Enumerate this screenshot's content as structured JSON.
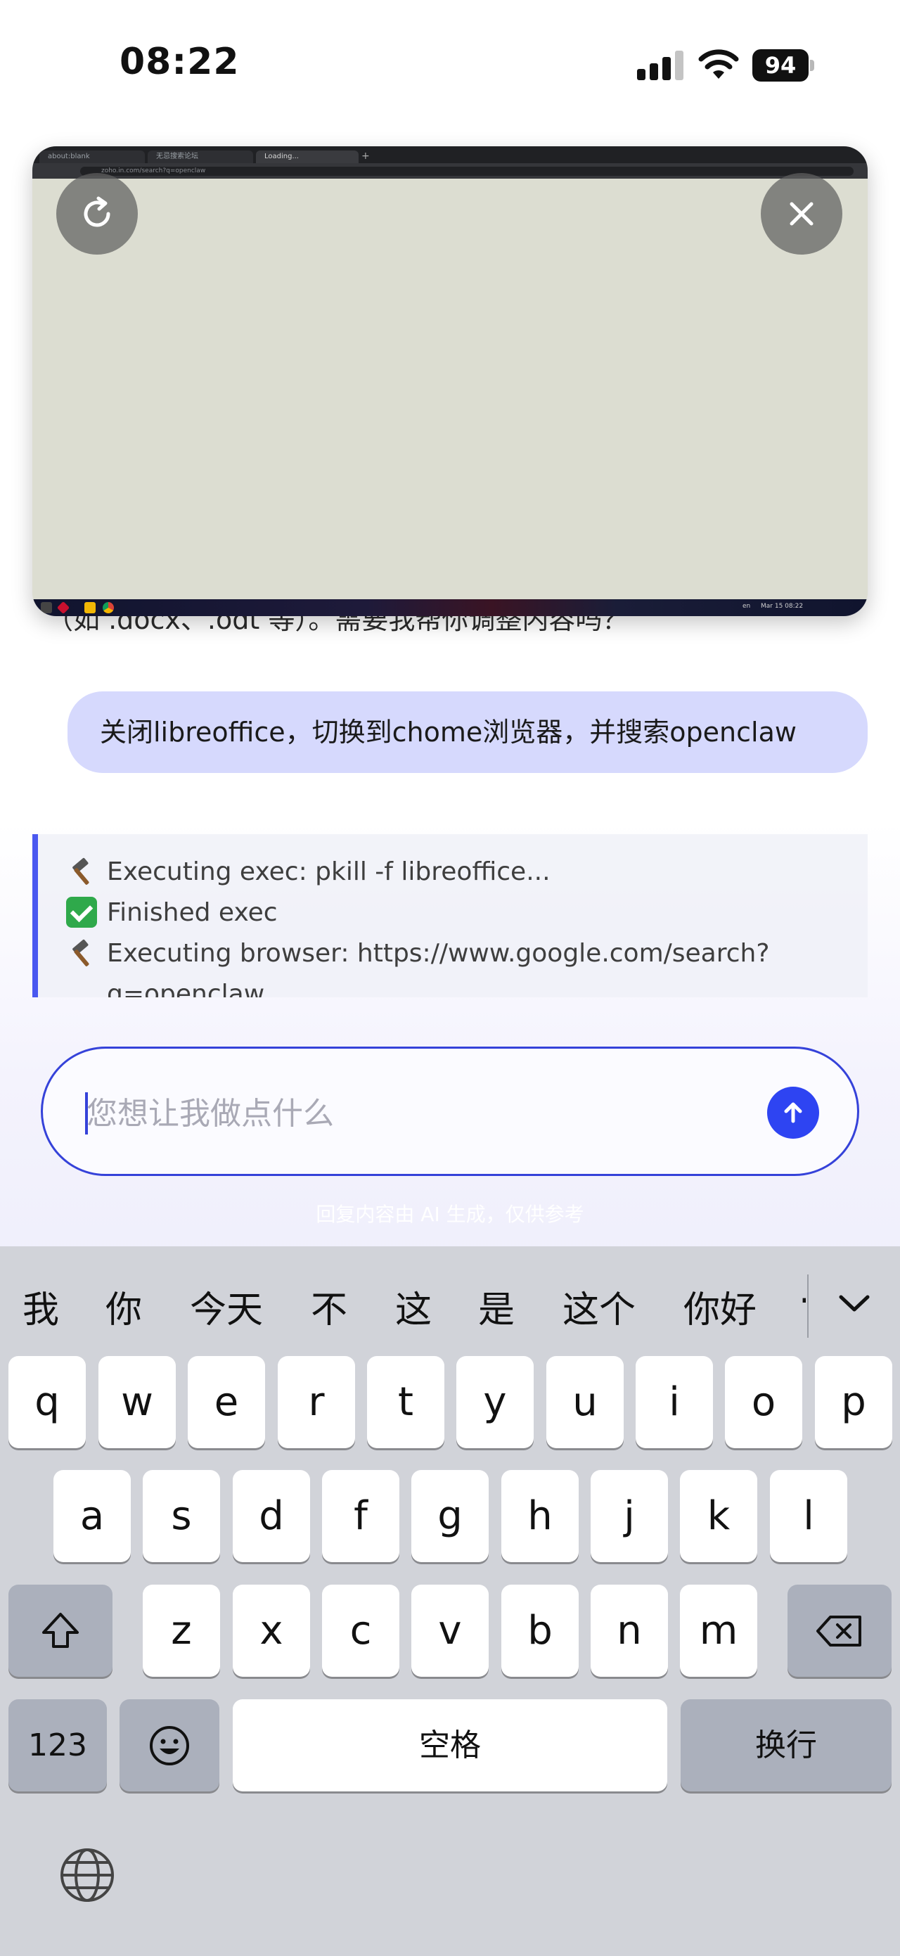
{
  "status_bar": {
    "time": "08:22",
    "battery": "94"
  },
  "chat": {
    "previous_reply_fragment": "（如 .docx、.odt 等）。需要我帮你调整内容吗？",
    "user_message": "关闭libreoffice，切换到chome浏览器，并搜索openclaw",
    "exec_log": [
      {
        "icon": "hammer-icon",
        "text": "Executing exec: pkill -f libreoffice..."
      },
      {
        "icon": "check-icon",
        "text": "Finished exec"
      },
      {
        "icon": "hammer-icon",
        "text": "Executing browser: https://www.google.com/search?"
      },
      {
        "icon": "",
        "text": "q=openclaw"
      }
    ]
  },
  "remote_browser": {
    "tabs": [
      "about:blank",
      "无忌搜索论坛",
      "Loading..."
    ],
    "new_tab": "+",
    "url": "zoho.in.com/search?q=openclaw",
    "tray": {
      "lang": "en",
      "datetime": "Mar 15 08:22"
    }
  },
  "input": {
    "placeholder": "您想让我做点什么",
    "value": ""
  },
  "disclaimer": "回复内容由 AI 生成，仅供参考",
  "keyboard": {
    "candidates": [
      "我",
      "你",
      "今天",
      "不",
      "这",
      "是",
      "这个",
      "你好",
      "·"
    ],
    "rows": [
      [
        "q",
        "w",
        "e",
        "r",
        "t",
        "y",
        "u",
        "i",
        "o",
        "p"
      ],
      [
        "a",
        "s",
        "d",
        "f",
        "g",
        "h",
        "j",
        "k",
        "l"
      ],
      [
        "z",
        "x",
        "c",
        "v",
        "b",
        "n",
        "m"
      ]
    ],
    "numbers_label": "123",
    "space_label": "空格",
    "return_label": "换行"
  },
  "colors": {
    "accent": "#3542d9",
    "send_button": "#2e44f2",
    "bubble": "#d6d9fd",
    "log_border": "#4a58f0"
  }
}
